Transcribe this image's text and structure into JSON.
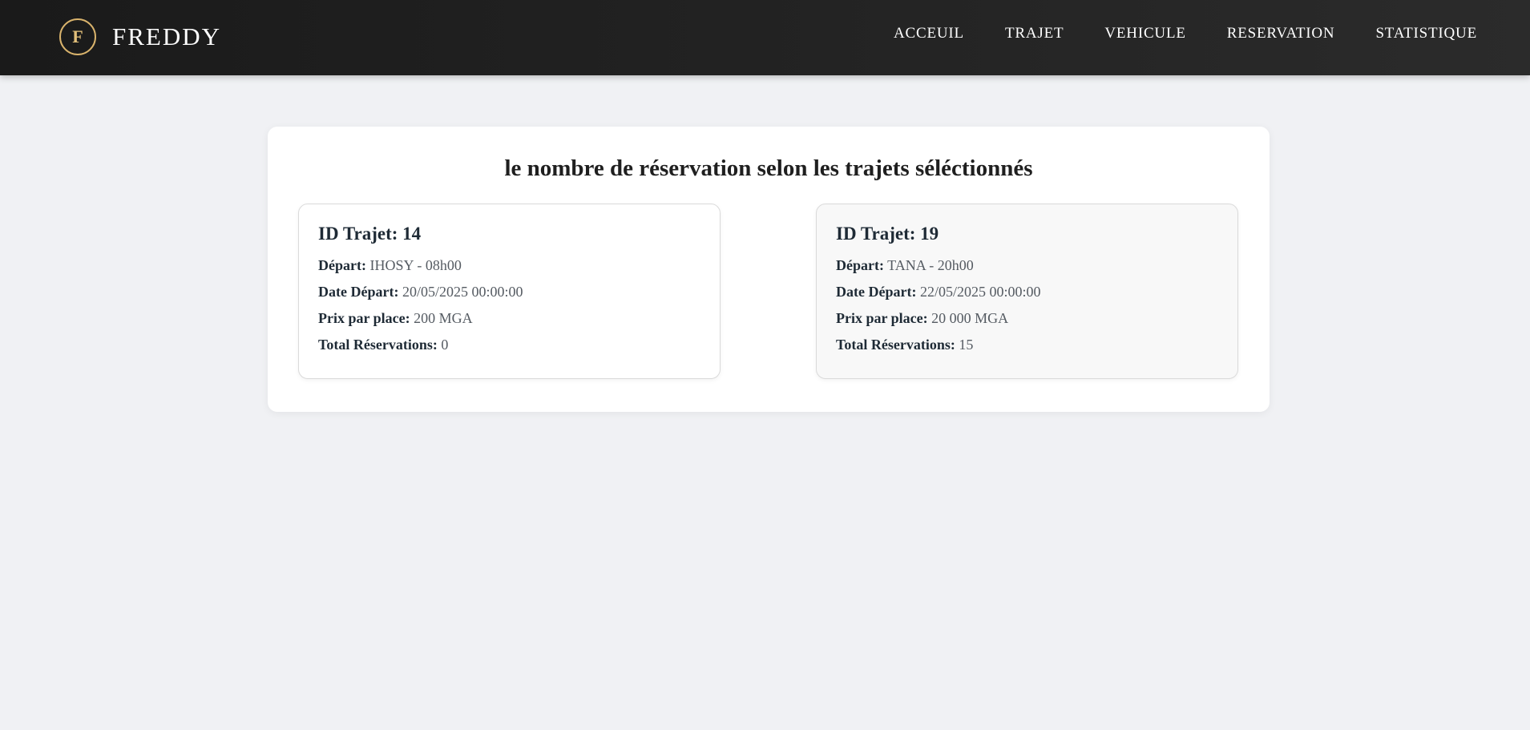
{
  "header": {
    "logo_letter": "F",
    "brand": "FREDDY",
    "nav": [
      "ACCEUIL",
      "TRAJET",
      "VEHICULE",
      "RESERVATION",
      "STATISTIQUE"
    ]
  },
  "main": {
    "title": "le nombre de réservation selon les trajets séléctionnés",
    "cards": [
      {
        "title": "ID Trajet: 14",
        "depart_label": "Départ:",
        "depart": "IHOSY - 08h00",
        "date_label": "Date Départ:",
        "date": "20/05/2025 00:00:00",
        "prix_label": "Prix par place:",
        "prix": "200 MGA",
        "total_label": "Total Réservations:",
        "total": "0"
      },
      {
        "title": "ID Trajet: 19",
        "depart_label": "Départ:",
        "depart": "TANA - 20h00",
        "date_label": "Date Départ:",
        "date": "22/05/2025 00:00:00",
        "prix_label": "Prix par place:",
        "prix": "20 000 MGA",
        "total_label": "Total Réservations:",
        "total": "15"
      }
    ]
  },
  "colors": {
    "accent_gold": "#d9b36c",
    "topbar": "#1f1f1f",
    "background": "#f0f1f4"
  }
}
